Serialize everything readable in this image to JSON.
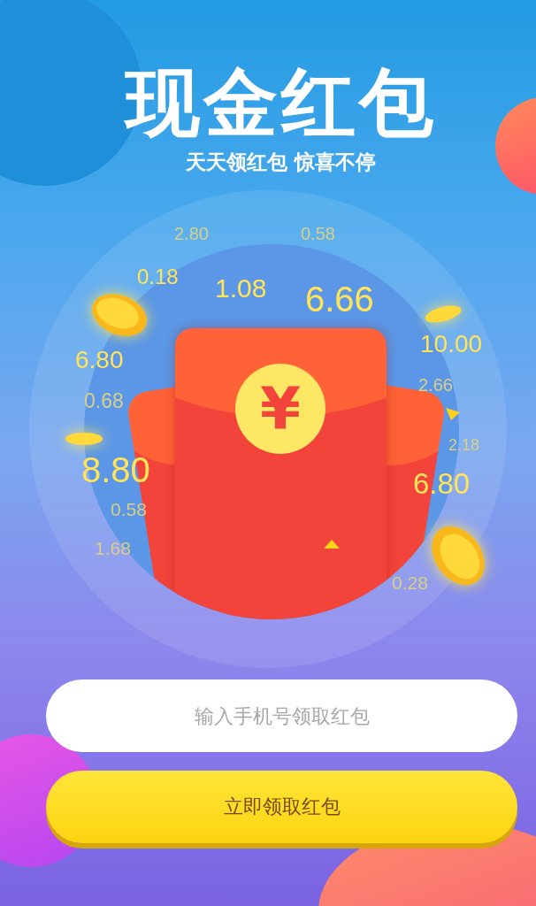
{
  "title": "现金红包",
  "subtitle": "天天领红包 惊喜不停",
  "envelope": {
    "symbol": "¥"
  },
  "amounts": [
    {
      "text": "2.80",
      "faint": true
    },
    {
      "text": "0.58",
      "faint": true
    },
    {
      "text": "0.18",
      "faint": false
    },
    {
      "text": "1.08",
      "faint": false
    },
    {
      "text": "6.66",
      "faint": false
    },
    {
      "text": "6.80",
      "faint": false
    },
    {
      "text": "10.00",
      "faint": false
    },
    {
      "text": "0.68",
      "faint": true
    },
    {
      "text": "2.66",
      "faint": true
    },
    {
      "text": "2.18",
      "faint": true
    },
    {
      "text": "8.80",
      "faint": false
    },
    {
      "text": "6.80",
      "faint": false
    },
    {
      "text": "0.58",
      "faint": true
    },
    {
      "text": "1.68",
      "faint": true
    },
    {
      "text": "0.28",
      "faint": true
    }
  ],
  "phone_field": {
    "placeholder": "输入手机号领取红包"
  },
  "claim_button": {
    "label": "立即领取红包"
  }
}
